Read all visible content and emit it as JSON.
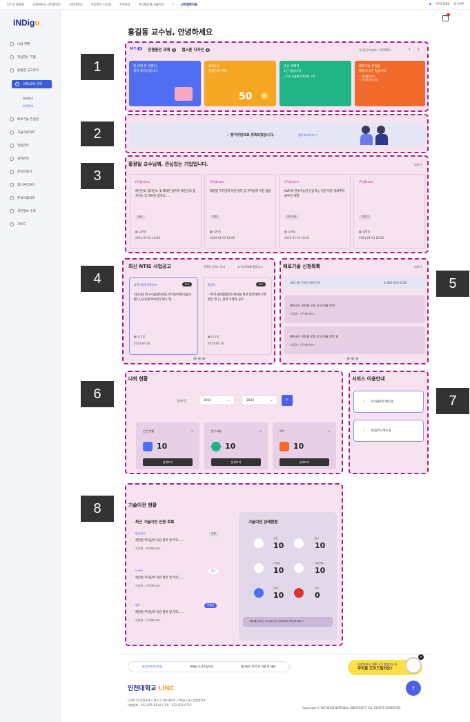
{
  "topbar": {
    "links": [
      "인디고 플랫폼",
      "인천대학교 산학협력단",
      "인천대학교",
      "사업관리 시스템",
      "가족회사",
      "지식재산권/기술이전"
    ],
    "center_logo": "산학협력지원",
    "user": "아이디002",
    "logout": "로그아웃"
  },
  "sidebar": {
    "brand_main": "INDig",
    "brand_accent": "o",
    "items": [
      "나의 현황",
      "관심있는 기업",
      "맞춤형 공고관리",
      "과제/교육 관리",
      "애로기술 컨설팅",
      "기술지원이트",
      "알림인트",
      "검색관리",
      "온라인평가",
      "캡스톤디자인",
      "분석시험의뢰",
      "개인정보 수정",
      "가이드"
    ],
    "subs": [
      "· 과제관리",
      "· 교육관리"
    ]
  },
  "greeting": "홍길동 교수님, 안녕하세요",
  "section_numbers": [
    "1",
    "2",
    "3",
    "4",
    "5",
    "6",
    "7",
    "8"
  ],
  "s1": {
    "tabs": [
      {
        "label": "MY",
        "count": "6"
      },
      {
        "label": "진행중인 과제",
        "count": "2"
      },
      {
        "label": "캡스톤 디자인",
        "count": "4"
      }
    ],
    "researcher_no": "국가연구자번호 : 10785%",
    "cards": [
      {
        "title": "일 년에 한 번뿐인,",
        "text": "생일 축하드립니다.",
        "color": "#4f6ef2"
      },
      {
        "title": "2023년",
        "text": "알림인트 현황",
        "value": "50",
        "unit": "P",
        "color": "#f5a623"
      },
      {
        "title": "승인 과제가",
        "text": "1건 있습니다.",
        "note": "• 학교 자율형 산학연계 교육",
        "color": "#20b486"
      },
      {
        "title": "애로기술 컨설팅",
        "text": "배정이 2건 있습니다.",
        "note1": "• (주)펜타코드",
        "note2": "• (주)목사미기업",
        "color": "#f26b2a"
      }
    ]
  },
  "s2": {
    "text": "✓ 평가위원으로 위촉되었습니다.",
    "link": "평가하러가기 >"
  },
  "s3": {
    "title": "황광일 교수님께, 관심있는 기업입니다.",
    "more": "더보기",
    "cards": [
      {
        "tag": "(주)펜타코드",
        "desc": "배전선로 접지인소 및 계자번 접지각 배전선로 접지인소 및 계자번 접지극......",
        "kind": "논문",
        "date_label": "검색일",
        "date": "2024-01-03 18:00"
      },
      {
        "tag": "(주)펜타코드",
        "desc": "해양형 부하장력 저감 항목 및 부하장력 저감 방법",
        "kind": "특허",
        "date_label": "검색일",
        "date": "2024-01-03 18:00"
      },
      {
        "tag": "(주)펜타코드",
        "desc": "NVR과 연동가능한 인공지능 기반 다중 객체추적 솔루션 개발",
        "kind": "연구과제",
        "date_label": "검색일",
        "date": "2024-01-03 18:00"
      },
      {
        "tag": "(주)펜타코드",
        "desc": "",
        "kind": "연구자",
        "date_label": "검색일",
        "date": "2024-01-03 18:00"
      }
    ]
  },
  "s4": {
    "title": "최신 NTIS 사업공고",
    "kw": "NTIS 키워드 관리",
    "rnd": "국가R&D 통합공고",
    "cards": [
      {
        "org": "과학기술정보통신부",
        "dday": "D-9",
        "text": "2023년 연구기술협력사업 (부처연계형기술개발) 신규과제 추보(안) 제고 및....",
        "date_label": "공고일",
        "date": "2023-06-16"
      },
      {
        "org": "종합부",
        "dday": "D-9",
        "text": "「지역사회통합문화 확산을 위한 협력체계 구축방안 연구」용역 수행자 공모",
        "date_label": "공고일",
        "date": "2023-06-16"
      }
    ]
  },
  "s5": {
    "title": "애로기술 신청목록",
    "more": "더보기",
    "header_text": "애로기술 컨설팅 배정 문의",
    "phone": "032-123-1234",
    "items": [
      {
        "title": "펜타코드 인턴쉽 모집 공고(겨울 방학)",
        "sub": "기업명 : (주)펜타코드"
      },
      {
        "title": "펜타코드 인턴쉽 모집 공고(겨울 방학 2)",
        "sub": "기업명 : (주)펜타코드"
      }
    ]
  },
  "s6": {
    "title": "나의 현황",
    "period_label": "검색기간",
    "from": "2021",
    "to": "2023",
    "stats": [
      {
        "label": "논문 현황",
        "value": "10",
        "btn": "상세보기",
        "color": "#4f6ef2"
      },
      {
        "label": "연구과제",
        "value": "10",
        "btn": "상세보기",
        "color": "#20b486"
      },
      {
        "label": "특허",
        "value": "10",
        "btn": "상세보기",
        "color": "#f26b2a"
      }
    ]
  },
  "s7": {
    "title": "서비스 이용안내",
    "items": [
      "지식재산권 매뉴얼",
      "사업관리 매뉴얼"
    ]
  },
  "s8": {
    "title": "기술이전 현황",
    "left_title": "최근 기술이전 신청 목록",
    "items": [
      {
        "tag": "통상실시",
        "status": "신청",
        "text": "해양형 부하장력 저감 항목 및 부하......",
        "sub": "기업명 : (주)펜타코드"
      },
      {
        "tag": "노하우",
        "status": "접수",
        "text": "해양형 부하장력 저감 항목 및 부하......",
        "sub": "기업명 : (주)펜타코드"
      },
      {
        "tag": "양도",
        "status": "진행중",
        "text": "해양형 부하장력 저감 항목 및 부하......",
        "sub": "기업명 : (주)펜타코드"
      }
    ],
    "right_title": "기술이전 상태현황",
    "stats": [
      {
        "label": "신청",
        "value": "10"
      },
      {
        "label": "접수",
        "value": "10"
      },
      {
        "label": "진행중",
        "value": "10"
      },
      {
        "label": "계약완료",
        "value": "10"
      },
      {
        "label": "완료",
        "value": "10"
      },
      {
        "label": "취소",
        "value": "0"
      }
    ],
    "footnote": "특허를 상태는 지식재산권 사이트에서 확인하세요 >"
  },
  "footer": {
    "links": [
      "개인정보처리방침",
      "이메일 무단수집거부",
      "개인정보 목적 외 이용 및 제한"
    ],
    "logo": "인천대학교",
    "logo_accent": "LINC",
    "addr1": "(22012) 인천광역시 연수구 아카데미로 119(송도동) 인천대학교",
    "addr2": "대표전화 : 032-835-8114  |  FAX : 032-832-0715",
    "copyright": "Copyright © INCHEON NATIONAL UNIVERSITY. ALL RIGHTS RESERVED.",
    "help_line1": "인천대학교 LINC3.0 챗봇입니다",
    "help_line2": "무엇을 도와드릴까요?",
    "help_close": "×",
    "top_btn": "↑"
  }
}
